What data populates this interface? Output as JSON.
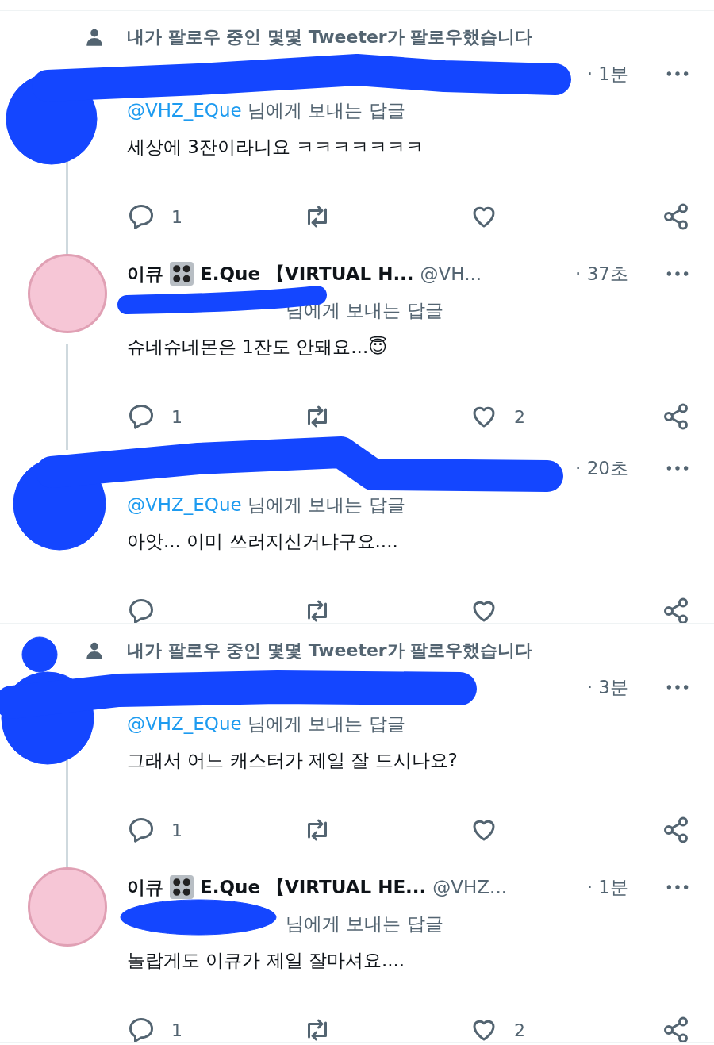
{
  "tweets": [
    {
      "social_context": "내가 팔로우 중인 몇몇 Tweeter가 팔로우했습니다",
      "redacted": true,
      "thread_end": false,
      "time": "· 1분",
      "reply_to": {
        "handle": "@VHZ_EQue",
        "suffix": "님에게 보내는 답글"
      },
      "text": "세상에 3잔이라니요 ㅋㅋㅋㅋㅋㅋㅋ",
      "replies": "1"
    },
    {
      "redacted": false,
      "thread_end": false,
      "name": "이큐",
      "name_rest": "E.Que 【VIRTUAL H...",
      "handle": "@VH...",
      "time": "· 37초",
      "reply_to": {
        "suffix": "님에게 보내는 답글"
      },
      "text": "슈네슈네몬은 1잔도 안돼요...😇",
      "replies": "1",
      "likes": "2"
    },
    {
      "redacted": true,
      "thread_end": true,
      "time": "· 20초",
      "reply_to": {
        "handle": "@VHZ_EQue",
        "suffix": "님에게 보내는 답글"
      },
      "text": "아앗... 이미 쓰러지신거냐구요...."
    },
    {
      "social_context": "내가 팔로우 중인 몇몇 Tweeter가 팔로우했습니다",
      "redacted": true,
      "thread_end": false,
      "time": "· 3분",
      "reply_to": {
        "handle": "@VHZ_EQue",
        "suffix": "님에게 보내는 답글"
      },
      "text": "그래서 어느 캐스터가 제일 잘 드시나요?",
      "replies": "1"
    },
    {
      "redacted": false,
      "thread_end": true,
      "name": "이큐",
      "name_rest": "E.Que 【VIRTUAL HE...",
      "handle": "@VHZ...",
      "time": "· 1분",
      "reply_to": {
        "suffix": "님에게 보내는 답글"
      },
      "text": "놀랍게도 이큐가 제일 잘마셔요....",
      "replies": "1",
      "likes": "2"
    }
  ]
}
